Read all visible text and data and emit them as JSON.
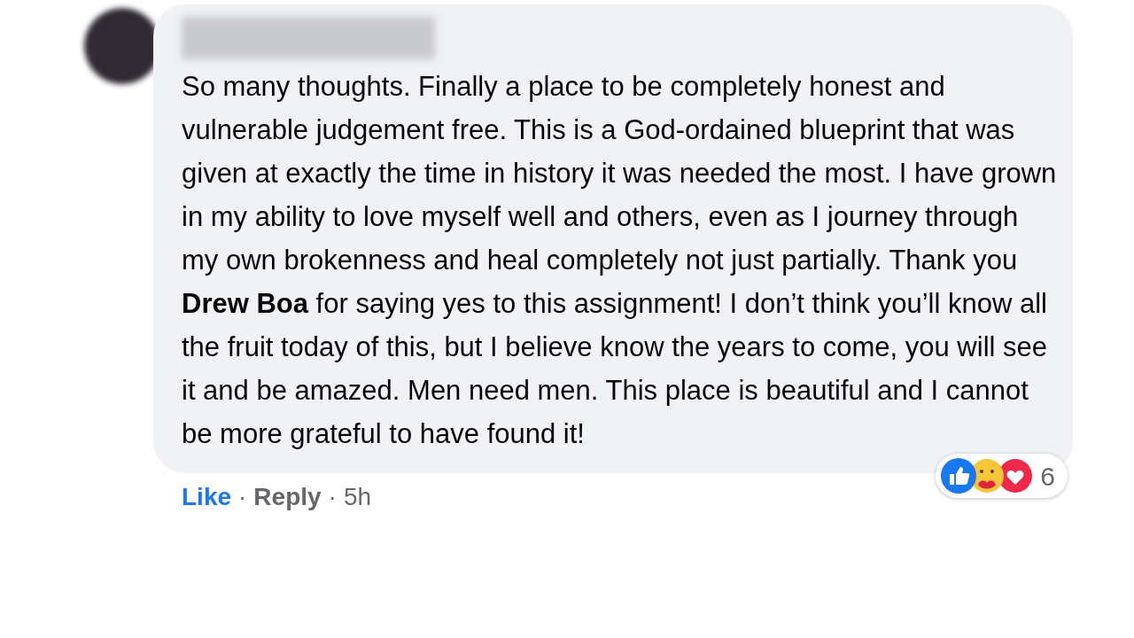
{
  "comment": {
    "text": "So many thoughts. Finally a place to be completely honest and vulnerable judgement free. This is a God-ordained blueprint that was given at exactly the time in history it was needed the most. I have grown in my ability to love myself well and others, even as I journey through my own brokenness and heal completely not just partially. Thank you **Drew Boa** for saying yes to this assignment! I don’t think you’ll know all the fruit today of this, but I believe know the years to come, you will see it and be amazed. Men need men. This place is beautiful and I cannot be more grateful to have found it!",
    "reaction_count": "6",
    "actions": [
      {
        "kind": "like",
        "label": "Like"
      },
      {
        "kind": "sep",
        "label": "·"
      },
      {
        "kind": "reply",
        "label": "Reply"
      },
      {
        "kind": "sep",
        "label": "·"
      },
      {
        "kind": "time",
        "label": "5h"
      }
    ]
  }
}
